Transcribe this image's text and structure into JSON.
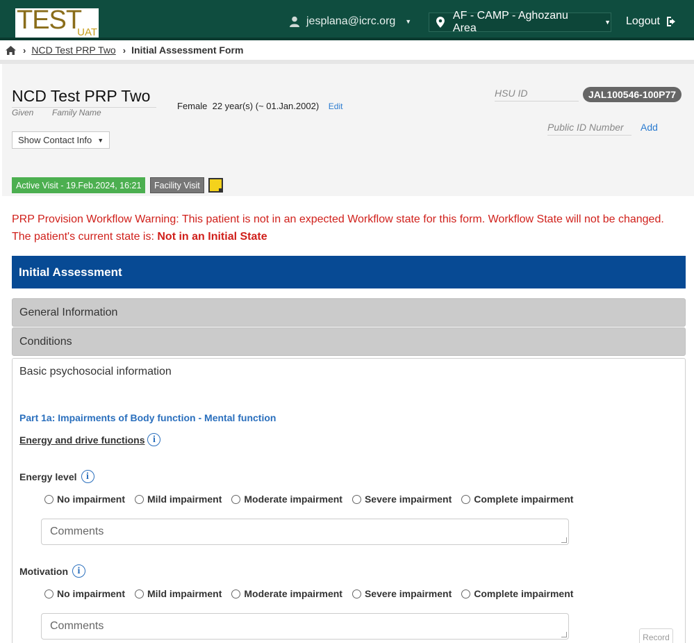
{
  "header": {
    "logo_text": "TEST",
    "logo_sub": "UAT",
    "user_email": "jesplana@icrc.org",
    "location": "AF - CAMP - Aghozanu Area",
    "logout_label": "Logout"
  },
  "breadcrumb": {
    "link": "NCD Test PRP Two",
    "current": "Initial Assessment Form"
  },
  "patient": {
    "name": "NCD Test PRP Two",
    "given_label": "Given",
    "family_label": "Family Name",
    "gender": "Female",
    "age": "22 year(s) (~ 01.Jan.2002)",
    "edit_label": "Edit",
    "contact_button": "Show Contact Info",
    "hsu_label": "HSU ID",
    "hsu_value": "JAL100546-100P77",
    "public_id_label": "Public ID Number",
    "public_id_add": "Add",
    "active_visit": "Active Visit - 19.Feb.2024, 16:21",
    "facility_visit": "Facility Visit"
  },
  "warning": {
    "line1": "PRP Provision Workflow Warning: This patient is not in an expected Workflow state for this form. Workflow State will not be changed.",
    "line2_prefix": "The patient's current state is: ",
    "state": "Not in an Initial State"
  },
  "form": {
    "title": "Initial Assessment",
    "sections": [
      "General Information",
      "Conditions",
      "Basic psychosocial information"
    ],
    "part_title": "Part 1a: Impairments of Body function - Mental function",
    "subsection": "Energy and drive functions",
    "questions": [
      {
        "label": "Energy level",
        "comments_placeholder": "Comments"
      },
      {
        "label": "Motivation",
        "comments_placeholder": "Comments"
      }
    ],
    "options": [
      "No impairment",
      "Mild impairment",
      "Moderate impairment",
      "Severe impairment",
      "Complete impairment"
    ],
    "record_label": "Record"
  },
  "colors": {
    "topbar": "#0f4d3f",
    "section_header": "#074a94",
    "active_visit": "#4caf50",
    "warning": "#d0201b",
    "link": "#2a7bd0"
  }
}
